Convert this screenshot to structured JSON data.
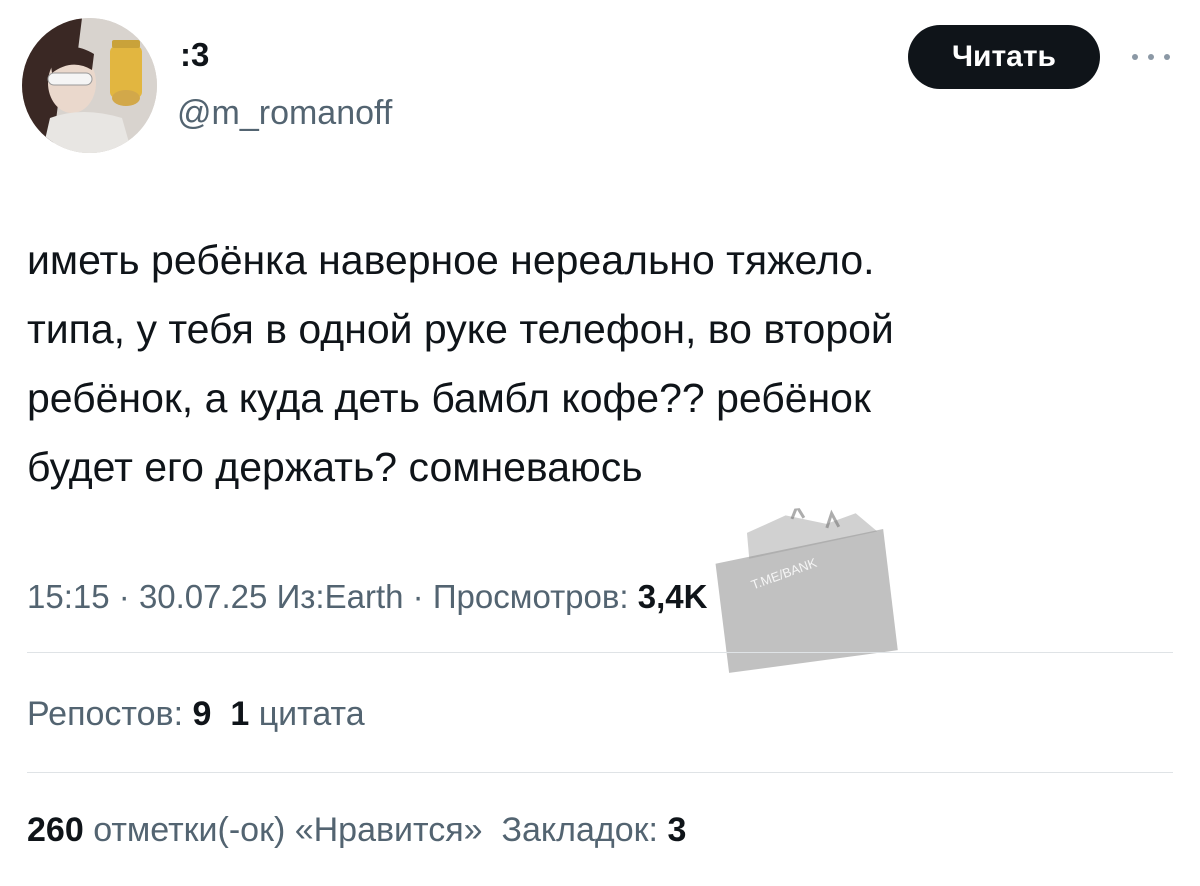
{
  "author": {
    "display_name": ":3",
    "handle": "@m_romanoff"
  },
  "follow_button_label": "Читать",
  "more_icon": "more-horizontal-icon",
  "tweet": {
    "text": "иметь ребёнка наверное нереально тяжело.\nтипа, у тебя в одной руке телефон, во второй\nребёнок, а куда деть бамбл кофе?? ребёнок\nбудет его держать? сомневаюсь"
  },
  "meta": {
    "time": "15:15",
    "separator": "·",
    "date": "30.07.25",
    "source": "Из:Earth",
    "views_label": "Просмотров:",
    "views_count": "3,4K"
  },
  "stats": {
    "reposts_label": "Репостов:",
    "reposts_count": "9",
    "quotes_count": "1",
    "quotes_label": "цитата",
    "likes_count": "260",
    "likes_label": "отметки(-ок) «Нравится»",
    "bookmarks_label": "Закладок:",
    "bookmarks_count": "3"
  },
  "watermark": {
    "text": "T.ME/BANK"
  },
  "colors": {
    "text_primary": "#0f1419",
    "text_secondary": "#536471",
    "button_bg": "#0f1419",
    "button_text": "#ffffff",
    "divider": "#dfe3e6"
  }
}
